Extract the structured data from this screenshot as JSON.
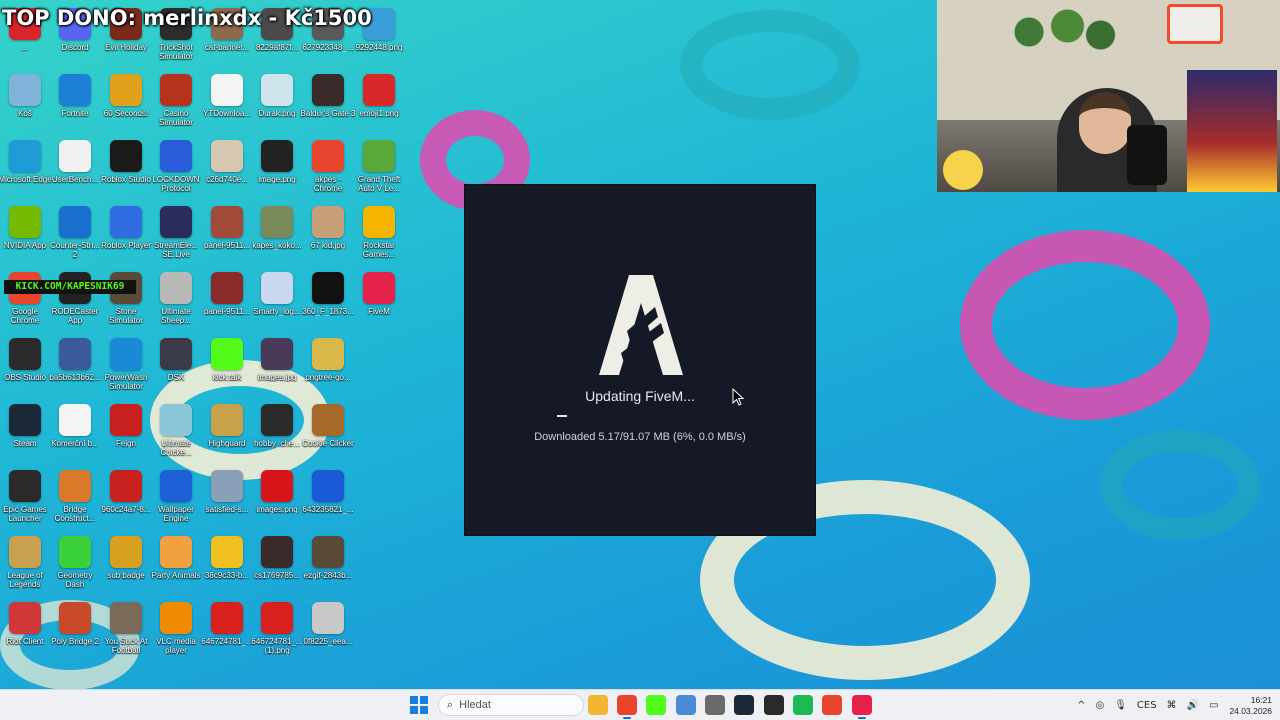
{
  "stream_title": "TOP DONO: merlinxdx - Kč1500",
  "kick_banner": "KICK.COM/KAPESNIK69",
  "colors": {
    "pink": "#d94fb0",
    "cream": "#f4eed6",
    "dialog_bg": "#141925",
    "accent": "#0078d4"
  },
  "desktop_icons": [
    {
      "label": "...",
      "icon": "app-red-icon",
      "color": "#d9252a"
    },
    {
      "label": "Discord",
      "icon": "discord-icon",
      "color": "#5865f2"
    },
    {
      "label": "Evil Holiday",
      "icon": "app-icon",
      "color": "#7a2a1a"
    },
    {
      "label": "TrickShot Simulator",
      "icon": "game-icon",
      "color": "#2c2c2c"
    },
    {
      "label": "cat-banner...",
      "icon": "image-icon",
      "color": "#8a6a4a"
    },
    {
      "label": "8229af87f...",
      "icon": "image-icon",
      "color": "#4a4a4a"
    },
    {
      "label": "627923348_...",
      "icon": "image-icon",
      "color": "#5a5a5a"
    },
    {
      "label": "9292448.png",
      "icon": "image-icon",
      "color": "#3a9fd8"
    },
    {
      "label": "Koš",
      "icon": "recycle-bin-icon",
      "color": "#7fb3d9"
    },
    {
      "label": "Fortnite",
      "icon": "fortnite-icon",
      "color": "#1e7fd6"
    },
    {
      "label": "60 Seconds!",
      "icon": "game-icon",
      "color": "#e0a21a"
    },
    {
      "label": "Casino Simulator",
      "icon": "game-icon",
      "color": "#b5331c"
    },
    {
      "label": "YTDownloa...",
      "icon": "download-icon",
      "color": "#f4f4f4"
    },
    {
      "label": "Durak.png",
      "icon": "image-icon",
      "color": "#cfe3ec"
    },
    {
      "label": "Baldur's Gate 3",
      "icon": "game-icon",
      "color": "#3b2a2a"
    },
    {
      "label": "emoji1.png",
      "icon": "image-icon",
      "color": "#d8282a"
    },
    {
      "label": "Microsoft Edge",
      "icon": "edge-icon",
      "color": "#1f9bd6"
    },
    {
      "label": "UserBench...",
      "icon": "gauge-icon",
      "color": "#f0f0f0"
    },
    {
      "label": "Roblox Studio",
      "icon": "roblox-icon",
      "color": "#1a1a1a"
    },
    {
      "label": "LOCKDOWN Protocol",
      "icon": "game-icon",
      "color": "#2a5ed8"
    },
    {
      "label": "c26d740e...",
      "icon": "image-icon",
      "color": "#d8c7b0"
    },
    {
      "label": "image.png",
      "icon": "image-icon",
      "color": "#222"
    },
    {
      "label": "akpes - Chrome",
      "icon": "chrome-icon",
      "color": "#e9442d"
    },
    {
      "label": "Grand Theft Auto V Le...",
      "icon": "gta-icon",
      "color": "#5aa83a"
    },
    {
      "label": "NVIDIA App",
      "icon": "nvidia-icon",
      "color": "#76b900"
    },
    {
      "label": "Counter-Stri... 2",
      "icon": "cs2-icon",
      "color": "#1a6fcf"
    },
    {
      "label": "Roblox Player",
      "icon": "roblox-icon",
      "color": "#2f6de1"
    },
    {
      "label": "StreamEle... SE.Live",
      "icon": "streamelements-icon",
      "color": "#2c2c5c"
    },
    {
      "label": "panel-9511...",
      "icon": "image-icon",
      "color": "#a14a3a"
    },
    {
      "label": "kapes_koko...",
      "icon": "image-icon",
      "color": "#7a8a5a"
    },
    {
      "label": "67 kid.jpg",
      "icon": "image-icon",
      "color": "#c7a07a"
    },
    {
      "label": "Rockstar Games...",
      "icon": "rockstar-icon",
      "color": "#f5b400"
    },
    {
      "label": "Google Chrome",
      "icon": "chrome-icon",
      "color": "#e9442d"
    },
    {
      "label": "RODECaster App",
      "icon": "rode-icon",
      "color": "#222"
    },
    {
      "label": "Stone Simulator",
      "icon": "game-icon",
      "color": "#5a4a3a"
    },
    {
      "label": "Ultimate Sheep...",
      "icon": "game-icon",
      "color": "#b8b8b8"
    },
    {
      "label": "panel-9511...",
      "icon": "image-icon",
      "color": "#8a2a2a"
    },
    {
      "label": "Smarty_log...",
      "icon": "image-icon",
      "color": "#c9d7f0"
    },
    {
      "label": "360_F_1873...",
      "icon": "image-icon",
      "color": "#111"
    },
    {
      "label": "FiveM",
      "icon": "fivem-icon",
      "color": "#e6224a"
    },
    {
      "label": "OBS Studio",
      "icon": "obs-icon",
      "color": "#2a2a2a"
    },
    {
      "label": "ba5b613b62...",
      "icon": "image-icon",
      "color": "#3a5a9a"
    },
    {
      "label": "PowerWash Simulator",
      "icon": "game-icon",
      "color": "#1a8ad6"
    },
    {
      "label": "DSX",
      "icon": "gamepad-icon",
      "color": "#3a3a4a"
    },
    {
      "label": "kick.talk",
      "icon": "kick-icon",
      "color": "#53fc18"
    },
    {
      "label": "images.jpg",
      "icon": "image-icon",
      "color": "#4a3a5a"
    },
    {
      "label": "pngtree-go...",
      "icon": "image-icon",
      "color": "#d9b84a"
    },
    {
      "label": "Steam",
      "icon": "steam-icon",
      "color": "#1b2838"
    },
    {
      "label": "Komerční b...",
      "icon": "bank-icon",
      "color": "#f4f4f4"
    },
    {
      "label": "Feign",
      "icon": "game-icon",
      "color": "#c8201f"
    },
    {
      "label": "Ultimate Chicke...",
      "icon": "game-icon",
      "color": "#8ac6d8"
    },
    {
      "label": "Highguard",
      "icon": "game-icon",
      "color": "#c9a14a"
    },
    {
      "label": "hobby_che...",
      "icon": "image-icon",
      "color": "#2a2a2a"
    },
    {
      "label": "Cookie Clicker",
      "icon": "cookie-icon",
      "color": "#a5692a"
    },
    {
      "label": "Epic Games Launcher",
      "icon": "epic-icon",
      "color": "#2a2a2a"
    },
    {
      "label": "Bridge Construct...",
      "icon": "game-icon",
      "color": "#d87a2a"
    },
    {
      "label": "960c24a7-8...",
      "icon": "image-icon",
      "color": "#c8201f"
    },
    {
      "label": "Wallpaper Engine",
      "icon": "wallpaper-engine-icon",
      "color": "#1f5fd6"
    },
    {
      "label": "satisfied-s...",
      "icon": "image-icon",
      "color": "#8aa0b8"
    },
    {
      "label": "images.png",
      "icon": "czech-flag-icon",
      "color": "#d7141a"
    },
    {
      "label": "643235821_...",
      "icon": "image-icon",
      "color": "#1a5ad6"
    },
    {
      "label": "League of Legends",
      "icon": "lol-icon",
      "color": "#c8a050"
    },
    {
      "label": "Geometry Dash",
      "icon": "geometry-dash-icon",
      "color": "#3ad13a"
    },
    {
      "label": "sub badge",
      "icon": "image-icon",
      "color": "#d8a020"
    },
    {
      "label": "Party Animals",
      "icon": "game-icon",
      "color": "#f0a040"
    },
    {
      "label": "38c9c33-b...",
      "icon": "image-icon",
      "color": "#f0c020"
    },
    {
      "label": "cs1769785...",
      "icon": "image-icon",
      "color": "#3a2a2a"
    },
    {
      "label": "ezgif-2843b...",
      "icon": "image-icon",
      "color": "#5a4a3a"
    },
    {
      "label": "Riot Client",
      "icon": "riot-icon",
      "color": "#d13639"
    },
    {
      "label": "Poly Bridge 2",
      "icon": "game-icon",
      "color": "#c84a2a"
    },
    {
      "label": "You Suck At Football",
      "icon": "game-icon",
      "color": "#7a6a5a"
    },
    {
      "label": "VLC media player",
      "icon": "vlc-icon",
      "color": "#f08a00"
    },
    {
      "label": "646724781_...",
      "icon": "image-icon",
      "color": "#d8201f"
    },
    {
      "label": "646724781_... (1).png",
      "icon": "image-icon",
      "color": "#d8201f"
    },
    {
      "label": "0f8225_eea...",
      "icon": "image-icon",
      "color": "#c8c8c8"
    }
  ],
  "dialog": {
    "title": "Updating FiveM...",
    "status": "Downloaded 5.17/91.07 MB (6%, 0.0 MB/s)",
    "progress": 0.06
  },
  "taskbar": {
    "search_placeholder": "Hledat",
    "apps": [
      {
        "icon": "file-explorer-icon",
        "color": "#f2b632"
      },
      {
        "icon": "chrome-icon",
        "color": "#e9442d"
      },
      {
        "icon": "kick-icon",
        "color": "#53fc18"
      },
      {
        "icon": "app-icon",
        "color": "#4a8ad6"
      },
      {
        "icon": "settings-icon",
        "color": "#6a6a6a"
      },
      {
        "icon": "steam-icon",
        "color": "#1b2838"
      },
      {
        "icon": "obs-icon",
        "color": "#2a2a2a"
      },
      {
        "icon": "spotify-icon",
        "color": "#1db954"
      },
      {
        "icon": "chrome-profile-icon",
        "color": "#e9442d"
      },
      {
        "icon": "fivem-icon",
        "color": "#e6224a"
      }
    ],
    "language": "CES",
    "time": "16:21",
    "date": "24.03.2026"
  }
}
